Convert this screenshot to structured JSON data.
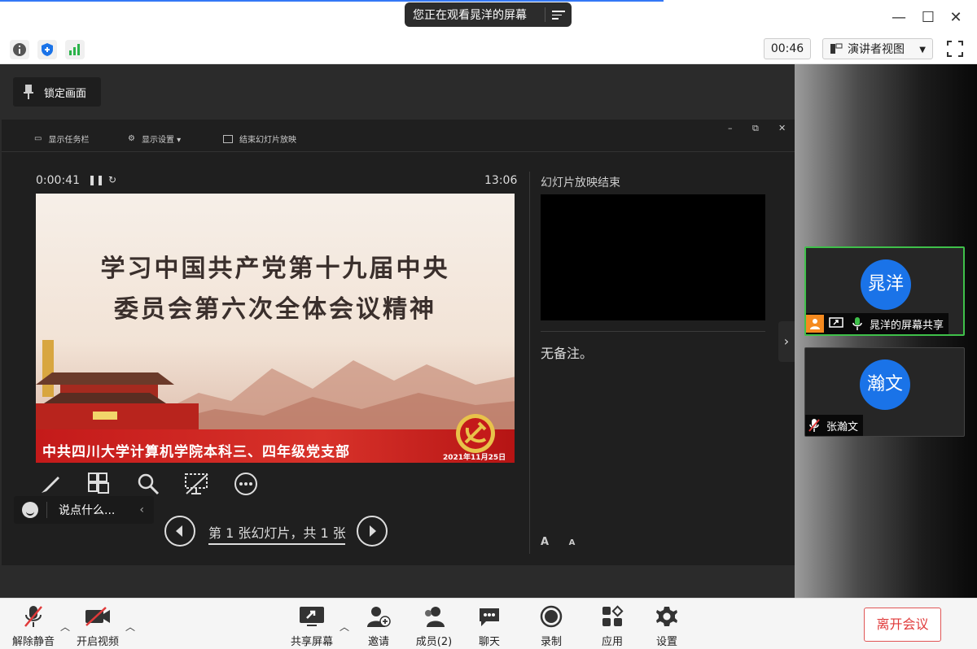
{
  "share_banner": {
    "text": "您正在观看晁洋的屏幕"
  },
  "toolbar": {
    "meeting_timer": "00:46",
    "view_mode": "演讲者视图"
  },
  "stage": {
    "lock_label": "锁定画面",
    "ppt_toolbar": {
      "show_taskbar": "显示任务栏",
      "display_settings": "显示设置 ▾",
      "end_slideshow": "结束幻灯片放映"
    },
    "elapsed_time": "0:00:41",
    "clock": "13:06",
    "slide": {
      "title_line1": "学习中国共产党第十九届中央",
      "title_line2": "委员会第六次全体会议精神",
      "footer": "中共四川大学计算机学院本科三、四年级党支部",
      "date": "2021年11月25日"
    },
    "next_slide_label": "幻灯片放映结束",
    "notes": "无备注。",
    "slide_counter": "第 1 张幻灯片，共 1 张",
    "font_increase": "A",
    "font_decrease": "A"
  },
  "chat": {
    "placeholder": "说点什么..."
  },
  "participants": [
    {
      "avatar_text": "晁洋",
      "name": "晁洋的屏幕共享",
      "active": true
    },
    {
      "avatar_text": "瀚文",
      "name": "张瀚文",
      "active": false
    }
  ],
  "bottom": {
    "unmute": "解除静音",
    "start_video": "开启视频",
    "share_screen": "共享屏幕",
    "invite": "邀请",
    "members": "成员(2)",
    "chat": "聊天",
    "record": "录制",
    "apps": "应用",
    "settings": "设置",
    "leave": "离开会议"
  },
  "colors": {
    "accent_blue": "#1a73e8",
    "active_green": "#3fc04a",
    "leave_red": "#e03a3a"
  }
}
